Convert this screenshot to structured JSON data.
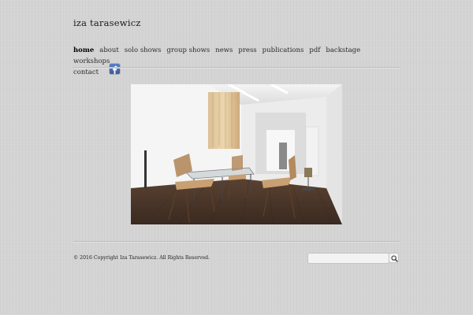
{
  "site": {
    "title": "iza tarasewicz"
  },
  "nav": {
    "items": [
      {
        "label": "home",
        "active": true
      },
      {
        "label": "about"
      },
      {
        "label": "solo shows"
      },
      {
        "label": "group shows"
      },
      {
        "label": "news"
      },
      {
        "label": "press"
      },
      {
        "label": "publications"
      },
      {
        "label": "pdf"
      },
      {
        "label": "backstage"
      },
      {
        "label": "workshops"
      },
      {
        "label": "contact"
      }
    ],
    "social_icon": "facebook-icon"
  },
  "footer": {
    "copyright": "© 2016 Copyright Iza Tarasewicz. All Rights Reserved.",
    "search_placeholder": "",
    "search_icon": "magnifier-icon"
  },
  "colors": {
    "background": "#d4d4d4",
    "facebook_blue": "#3b5998"
  }
}
